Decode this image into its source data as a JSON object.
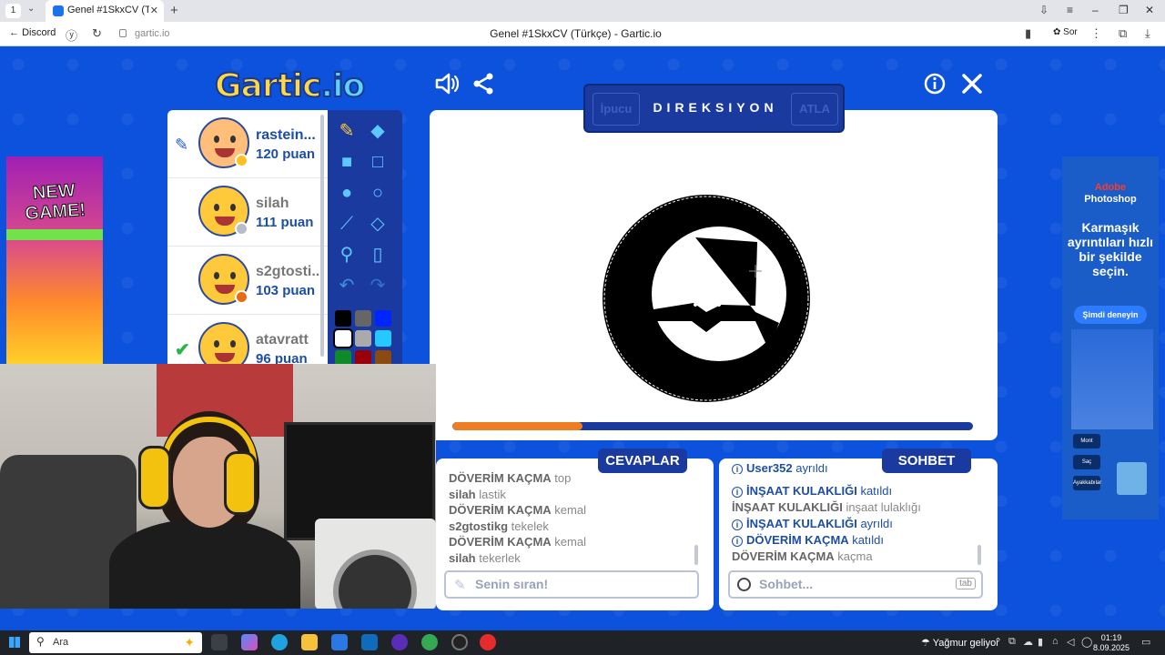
{
  "browser": {
    "tab_number": "1",
    "tab_title": "Genel #1SkxCV (Türkçe)",
    "page_title": "Genel #1SkxCV (Türkçe) - Gartic.io",
    "back_label": "Discord",
    "url": "gartic.io",
    "sor_label": "Sor"
  },
  "game": {
    "logo": "Gartic",
    "logo_suffix": ".io",
    "hint_label": "İpucu",
    "word": "DIREKSIYON",
    "skip_label": "ATLA",
    "progress": 0.25
  },
  "players": [
    {
      "name": "rastein...",
      "points": "120 puan",
      "status_color": "#ffc120",
      "drawing": true,
      "guessed": false
    },
    {
      "name": "silah",
      "points": "111 puan",
      "status_color": "#b7bcc6",
      "drawing": false,
      "guessed": false
    },
    {
      "name": "s2gtosti...",
      "points": "103 puan",
      "status_color": "#e76a17",
      "drawing": false,
      "guessed": false
    },
    {
      "name": "atavratt",
      "points": "96 puan",
      "status_color": "#1d4ea6",
      "drawing": false,
      "guessed": true
    }
  ],
  "palette": [
    "#000000",
    "#666666",
    "#0026ff",
    "#ffffff",
    "#aaaaaa",
    "#26c9ff",
    "#0e8a28",
    "#99000a",
    "#8a4a10"
  ],
  "answers": {
    "tab_label": "CEVAPLAR",
    "messages": [
      {
        "user": "DÖVERİM KAÇMA",
        "text": "top"
      },
      {
        "user": "silah",
        "text": "lastik"
      },
      {
        "user": "DÖVERİM KAÇMA",
        "text": "kemal"
      },
      {
        "user": "s2gtostikg",
        "text": "tekelek"
      },
      {
        "user": "DÖVERİM KAÇMA",
        "text": "kemal"
      },
      {
        "user": "silah",
        "text": "tekerlek"
      }
    ],
    "input_placeholder": "Senin sıran!"
  },
  "chat": {
    "tab_label": "SOHBET",
    "messages": [
      {
        "type": "system",
        "user": "User352",
        "text": "ayrıldı"
      },
      {
        "type": "system",
        "user": "İNŞAAT KULAKLIĞI",
        "text": "katıldı"
      },
      {
        "type": "chat",
        "user": "İNŞAAT KULAKLIĞI",
        "text": "inşaat lulaklığı"
      },
      {
        "type": "system",
        "user": "İNŞAAT KULAKLIĞI",
        "text": "ayrıldı"
      },
      {
        "type": "system",
        "user": "DÖVERİM KAÇMA",
        "text": "katıldı"
      },
      {
        "type": "chat",
        "user": "DÖVERİM KAÇMA",
        "text": "kaçma"
      }
    ],
    "input_placeholder": "Sohbet...",
    "tab_hint": "tab"
  },
  "ads": {
    "left_text": "NEW GAME!",
    "right_brand": "Adobe",
    "right_product": "Photoshop",
    "right_copy": "Karmaşık ayrıntıları hızlı bir şekilde seçin.",
    "right_cta": "Şimdi deneyin",
    "right_chips": [
      "Mont",
      "Saç",
      "Ayakkabılar"
    ]
  },
  "taskbar": {
    "search_placeholder": "Ara",
    "weather": "Yağmur geliyor",
    "time": "01:19",
    "date": "8.09.2025"
  }
}
